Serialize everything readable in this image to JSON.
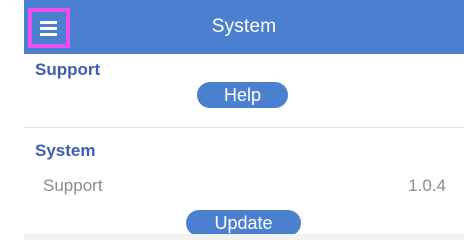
{
  "header": {
    "title": "System",
    "menu_icon": "hamburger-menu-icon",
    "bar_color": "#4b7fd0",
    "highlight_color": "#ee4ff0"
  },
  "support_section": {
    "title": "Support",
    "help_button": "Help"
  },
  "system_section": {
    "title": "System",
    "row": {
      "label": "Support",
      "value": "1.0.4"
    },
    "update_button": "Update"
  },
  "colors": {
    "accent": "#4b7fd0",
    "section_title": "#3b5fae",
    "muted_text": "#8b8b8b"
  }
}
